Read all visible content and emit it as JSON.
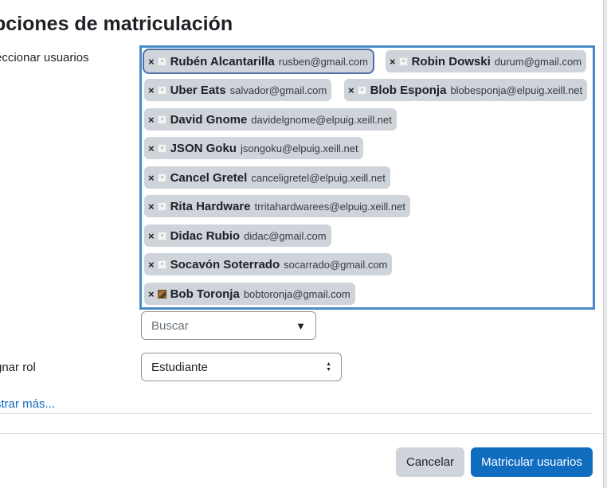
{
  "modal": {
    "title": "pciones de matriculación",
    "select_users_label": "eccionar usuarios",
    "assign_role_label": "gnar rol",
    "show_more_link": "strar más...",
    "cancel_button": "Cancelar",
    "enrol_button": "Matricular usuarios"
  },
  "search": {
    "placeholder": "Buscar",
    "caret_icon": "▼"
  },
  "role": {
    "selected": "Estudiante"
  },
  "selected_users": [
    {
      "remove": "×",
      "name": "Rubén Alcantarilla",
      "email": "rusben@gmail.com",
      "avatar": "default-avatar-icon"
    },
    {
      "remove": "×",
      "name": "Robin Dowski",
      "email": "durum@gmail.com",
      "avatar": "default-avatar-icon"
    },
    {
      "remove": "×",
      "name": "Uber Eats",
      "email": "salvador@gmail.com",
      "avatar": "default-avatar-icon"
    },
    {
      "remove": "×",
      "name": "Blob Esponja",
      "email": "blobesponja@elpuig.xeill.net",
      "avatar": "default-avatar-icon"
    },
    {
      "remove": "×",
      "name": "David Gnome",
      "email": "davidelgnome@elpuig.xeill.net",
      "avatar": "default-avatar-icon"
    },
    {
      "remove": "×",
      "name": "JSON Goku",
      "email": "jsongoku@elpuig.xeill.net",
      "avatar": "default-avatar-icon"
    },
    {
      "remove": "×",
      "name": "Cancel Gretel",
      "email": "canceligretel@elpuig.xeill.net",
      "avatar": "default-avatar-icon"
    },
    {
      "remove": "×",
      "name": "Rita Hardware",
      "email": "trritahardwarees@elpuig.xeill.net",
      "avatar": "default-avatar-icon"
    },
    {
      "remove": "×",
      "name": "Didac Rubio",
      "email": "didac@gmail.com",
      "avatar": "default-avatar-icon"
    },
    {
      "remove": "×",
      "name": "Socavón Soterrado",
      "email": "socarrado@gmail.com",
      "avatar": "default-avatar-icon"
    },
    {
      "remove": "×",
      "name": "Bob Toronja",
      "email": "bobtoronja@gmail.com",
      "avatar": "photo-avatar"
    }
  ],
  "colors": {
    "primary": "#0f6cbf",
    "chip": "#ced4da",
    "focus_border": "#4a8ac9",
    "text": "#1d2125"
  }
}
